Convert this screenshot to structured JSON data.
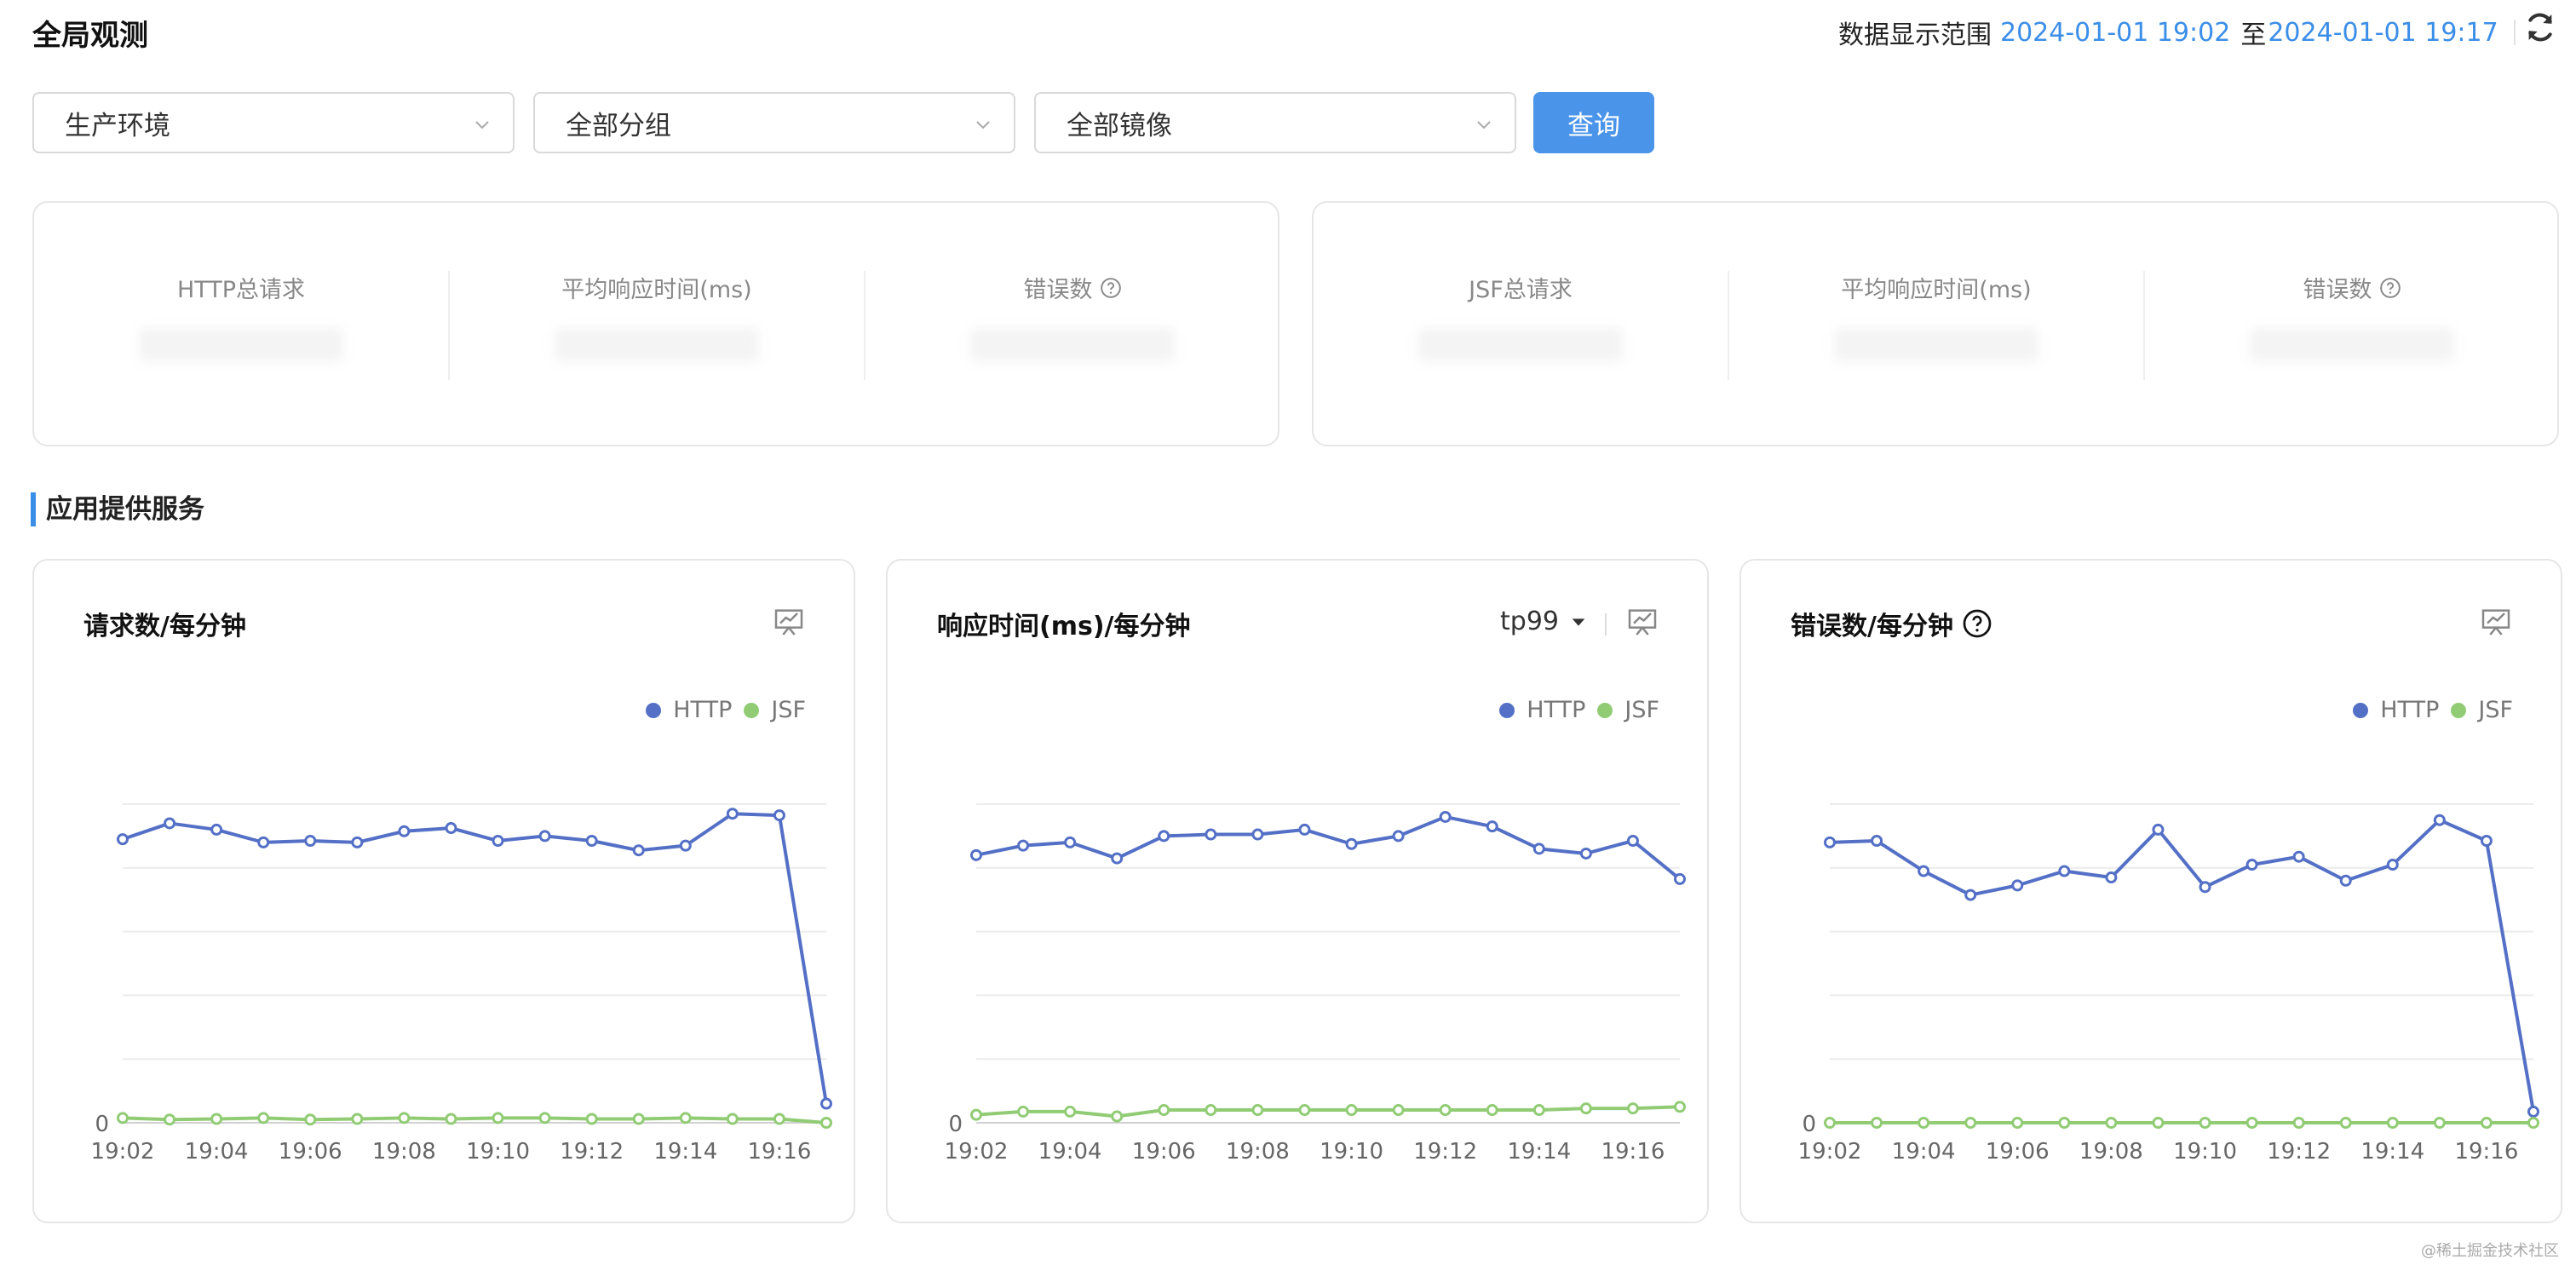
{
  "header": {
    "title": "全局观测",
    "range_label": "数据显示范围",
    "range_start": "2024-01-01 19:02",
    "range_to": "至",
    "range_end": "2024-01-01 19:17"
  },
  "filters": {
    "env": "生产环境",
    "group": "全部分组",
    "image": "全部镜像",
    "query_label": "查询"
  },
  "summary": {
    "http": {
      "total_label": "HTTP总请求",
      "avg_label": "平均响应时间(ms)",
      "error_label": "错误数"
    },
    "jsf": {
      "total_label": "JSF总请求",
      "avg_label": "平均响应时间(ms)",
      "error_label": "错误数"
    }
  },
  "section": {
    "title": "应用提供服务"
  },
  "colors": {
    "http": "#5470c6",
    "jsf": "#91cc75",
    "accent": "#3b8ee8"
  },
  "charts": {
    "requests": {
      "title": "请求数/每分钟"
    },
    "response": {
      "title": "响应时间(ms)/每分钟",
      "selector": "tp99"
    },
    "errors": {
      "title": "错误数/每分钟"
    }
  },
  "chart_data": [
    {
      "type": "line",
      "x": [
        "19:02",
        "19:03",
        "19:04",
        "19:05",
        "19:06",
        "19:07",
        "19:08",
        "19:09",
        "19:10",
        "19:11",
        "19:12",
        "19:13",
        "19:14",
        "19:15",
        "19:16",
        "19:17"
      ],
      "tick_labels": [
        "19:02",
        "19:04",
        "19:06",
        "19:08",
        "19:10",
        "19:12",
        "19:14",
        "19:16"
      ],
      "y_zero_label": "0",
      "ylim": [
        0,
        100
      ],
      "grid": true,
      "legend": "top-right",
      "series": [
        {
          "name": "HTTP",
          "values": [
            89,
            94,
            92,
            88,
            88.5,
            88,
            91.5,
            92.5,
            88.5,
            90,
            88.5,
            85.5,
            87,
            97,
            96.5,
            6
          ]
        },
        {
          "name": "JSF",
          "values": [
            1.5,
            1,
            1.2,
            1.5,
            1,
            1.2,
            1.5,
            1.2,
            1.5,
            1.5,
            1.2,
            1.2,
            1.5,
            1.2,
            1.2,
            0
          ]
        }
      ]
    },
    {
      "type": "line",
      "x": [
        "19:02",
        "19:03",
        "19:04",
        "19:05",
        "19:06",
        "19:07",
        "19:08",
        "19:09",
        "19:10",
        "19:11",
        "19:12",
        "19:13",
        "19:14",
        "19:15",
        "19:16",
        "19:17"
      ],
      "tick_labels": [
        "19:02",
        "19:04",
        "19:06",
        "19:08",
        "19:10",
        "19:12",
        "19:14",
        "19:16"
      ],
      "y_zero_label": "0",
      "ylim": [
        0,
        100
      ],
      "grid": true,
      "legend": "top-right",
      "series": [
        {
          "name": "HTTP",
          "values": [
            84,
            87,
            88,
            83,
            90,
            90.5,
            90.5,
            92,
            87.5,
            90,
            96,
            93,
            86,
            84.5,
            88.5,
            76.5
          ]
        },
        {
          "name": "JSF",
          "values": [
            2.5,
            3.5,
            3.5,
            2,
            4,
            4,
            4,
            4,
            4,
            4,
            4,
            4,
            4,
            4.5,
            4.5,
            5
          ]
        }
      ]
    },
    {
      "type": "line",
      "x": [
        "19:02",
        "19:03",
        "19:04",
        "19:05",
        "19:06",
        "19:07",
        "19:08",
        "19:09",
        "19:10",
        "19:11",
        "19:12",
        "19:13",
        "19:14",
        "19:15",
        "19:16",
        "19:17"
      ],
      "tick_labels": [
        "19:02",
        "19:04",
        "19:06",
        "19:08",
        "19:10",
        "19:12",
        "19:14",
        "19:16"
      ],
      "y_zero_label": "0",
      "ylim": [
        0,
        100
      ],
      "grid": true,
      "legend": "top-right",
      "series": [
        {
          "name": "HTTP",
          "values": [
            88,
            88.5,
            79,
            71.5,
            74.5,
            79,
            77,
            92,
            74,
            81,
            83.5,
            76,
            81,
            95,
            88.5,
            3.5
          ]
        },
        {
          "name": "JSF",
          "values": [
            0,
            0,
            0,
            0,
            0,
            0,
            0,
            0,
            0,
            0,
            0,
            0,
            0,
            0,
            0,
            0
          ]
        }
      ]
    }
  ]
}
